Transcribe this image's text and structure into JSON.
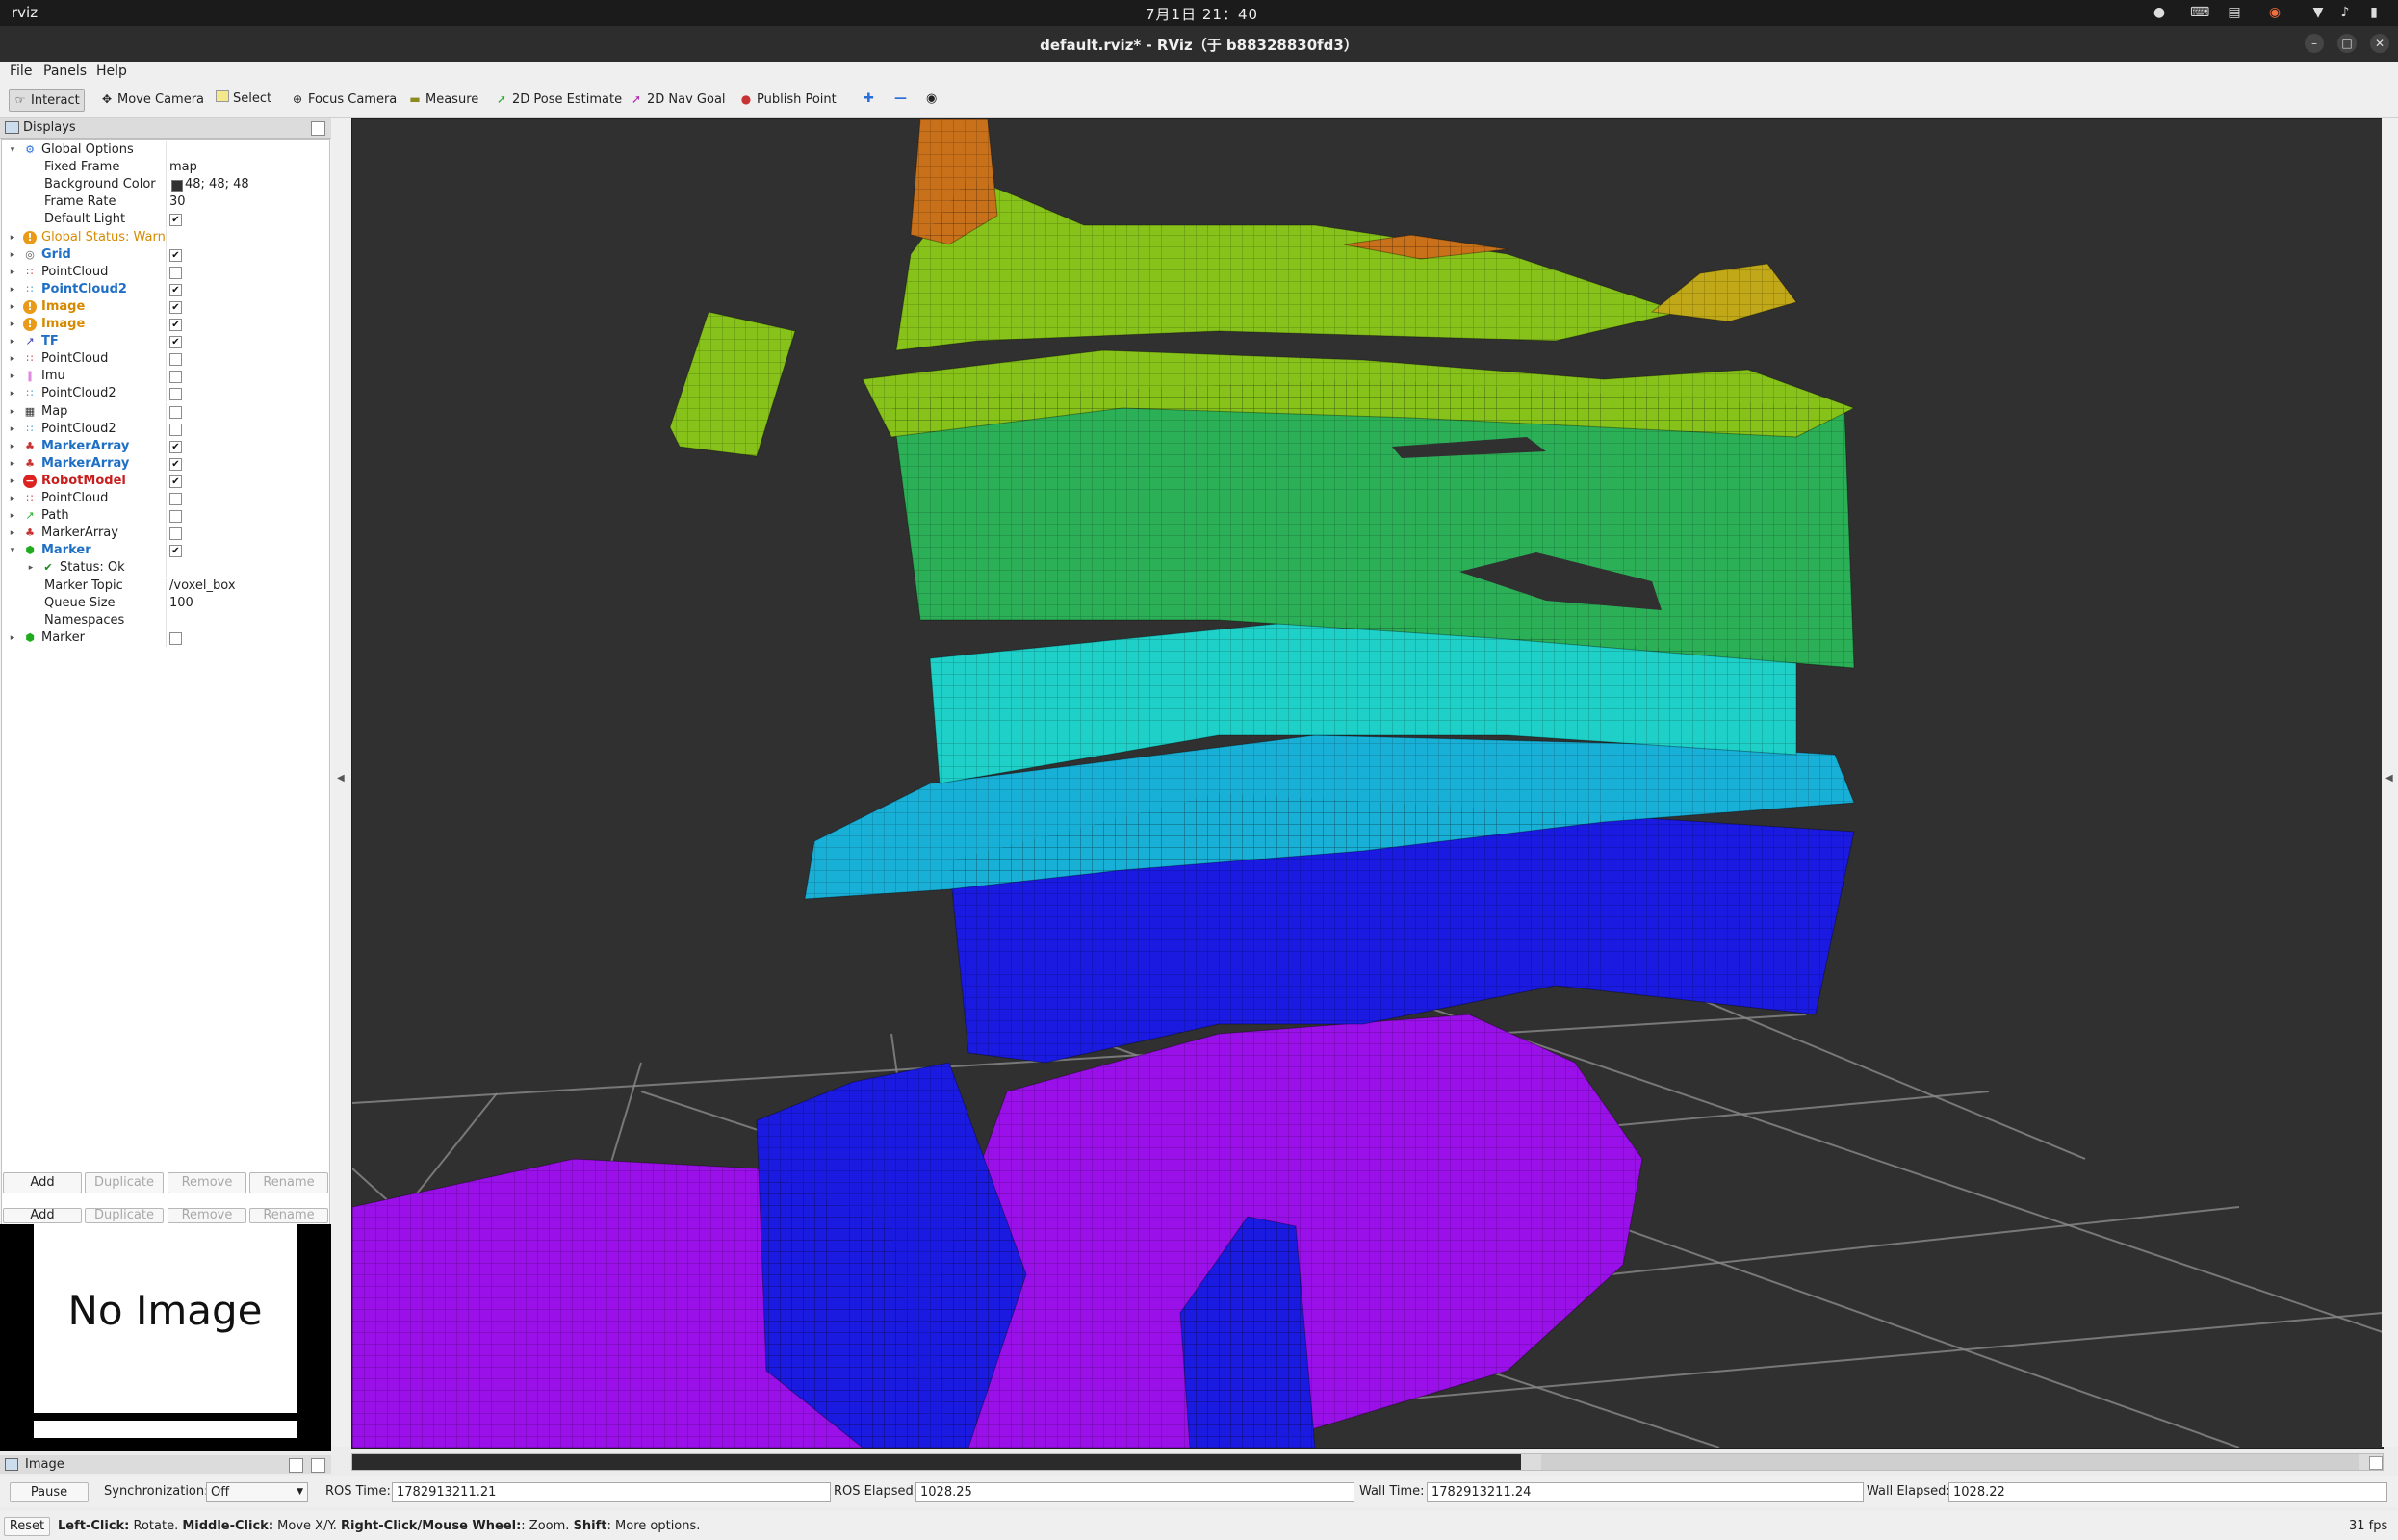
{
  "system_bar": {
    "app_name": "rviz",
    "clock": "7月1日 21：40"
  },
  "window": {
    "title": "default.rviz* - RViz（于 b88328830fd3）"
  },
  "menu": [
    "File",
    "Panels",
    "Help"
  ],
  "toolbar": {
    "tools": [
      {
        "label": "Interact",
        "icon": "interact-icon",
        "active": true
      },
      {
        "label": "Move Camera",
        "icon": "move-camera-icon"
      },
      {
        "label": "Select",
        "icon": "select-icon"
      },
      {
        "label": "Focus Camera",
        "icon": "focus-camera-icon"
      },
      {
        "label": "Measure",
        "icon": "measure-icon"
      },
      {
        "label": "2D Pose Estimate",
        "icon": "pose-estimate-icon"
      },
      {
        "label": "2D Nav Goal",
        "icon": "nav-goal-icon"
      },
      {
        "label": "Publish Point",
        "icon": "publish-point-icon"
      }
    ]
  },
  "displays": {
    "title": "Displays",
    "rows": [
      {
        "label": "Global Options",
        "arrow": "open",
        "icon": "gear-icon",
        "color": "#222"
      },
      {
        "label": "Fixed Frame",
        "value": "map",
        "indent": 2
      },
      {
        "label": "Background Color",
        "value": "48; 48; 48",
        "indent": 2,
        "swatch": "#303030"
      },
      {
        "label": "Frame Rate",
        "value": "30",
        "indent": 2
      },
      {
        "label": "Default Light",
        "check": true,
        "indent": 2
      },
      {
        "label": "Global Status: Warn",
        "arrow": "closed",
        "icon": "warning-icon",
        "color": "#d78a00"
      },
      {
        "label": "Grid",
        "arrow": "closed",
        "icon": "grid-icon",
        "check": true,
        "color": "#1f6fc5",
        "bold": true
      },
      {
        "label": "PointCloud",
        "arrow": "closed",
        "icon": "pointcloud-icon",
        "check": false
      },
      {
        "label": "PointCloud2",
        "arrow": "closed",
        "icon": "pointcloud2-icon",
        "check": true,
        "color": "#1f6fc5",
        "bold": true
      },
      {
        "label": "Image",
        "arrow": "closed",
        "icon": "warning-icon",
        "check": true,
        "color": "#d78a00",
        "bold": true
      },
      {
        "label": "Image",
        "arrow": "closed",
        "icon": "warning-icon",
        "check": true,
        "color": "#d78a00",
        "bold": true
      },
      {
        "label": "TF",
        "arrow": "closed",
        "icon": "tf-icon",
        "check": true,
        "color": "#1f6fc5",
        "bold": true
      },
      {
        "label": "PointCloud",
        "arrow": "closed",
        "icon": "pointcloud-icon",
        "check": false
      },
      {
        "label": "Imu",
        "arrow": "closed",
        "icon": "imu-icon",
        "check": false
      },
      {
        "label": "PointCloud2",
        "arrow": "closed",
        "icon": "pointcloud2-icon",
        "check": false
      },
      {
        "label": "Map",
        "arrow": "closed",
        "icon": "map-icon",
        "check": false
      },
      {
        "label": "PointCloud2",
        "arrow": "closed",
        "icon": "pointcloud2-icon",
        "check": false
      },
      {
        "label": "MarkerArray",
        "arrow": "closed",
        "icon": "marker-array-icon",
        "check": true,
        "color": "#1f6fc5",
        "bold": true
      },
      {
        "label": "MarkerArray",
        "arrow": "closed",
        "icon": "marker-array-icon",
        "check": true,
        "color": "#1f6fc5",
        "bold": true
      },
      {
        "label": "RobotModel",
        "arrow": "closed",
        "icon": "error-icon",
        "check": true,
        "color": "#c81e1e",
        "bold": true
      },
      {
        "label": "PointCloud",
        "arrow": "closed",
        "icon": "pointcloud-icon",
        "check": false
      },
      {
        "label": "Path",
        "arrow": "closed",
        "icon": "path-icon",
        "check": false
      },
      {
        "label": "MarkerArray",
        "arrow": "closed",
        "icon": "marker-array-icon",
        "check": false
      },
      {
        "label": "Marker",
        "arrow": "open",
        "icon": "marker-icon",
        "check": true,
        "color": "#1f6fc5",
        "bold": true
      },
      {
        "label": "Status: Ok",
        "arrow": "closed",
        "icon": "check-icon",
        "indent": 1
      },
      {
        "label": "Marker Topic",
        "value": "/voxel_box",
        "indent": 2
      },
      {
        "label": "Queue Size",
        "value": "100",
        "indent": 2
      },
      {
        "label": "Namespaces",
        "indent": 2
      },
      {
        "label": "Marker",
        "arrow": "closed",
        "icon": "marker-icon",
        "check": false
      }
    ],
    "buttons": [
      "Add",
      "Duplicate",
      "Remove",
      "Rename"
    ]
  },
  "image_panel": {
    "message": "No Image",
    "title": "Image"
  },
  "timebar": {
    "pause": "Pause",
    "sync_label": "Synchronization:",
    "sync_value": "Off",
    "ros_time_label": "ROS Time:",
    "ros_time": "1782913211.21",
    "ros_elapsed_label": "ROS Elapsed:",
    "ros_elapsed": "1028.25",
    "wall_time_label": "Wall Time:",
    "wall_time": "1782913211.24",
    "wall_elapsed_label": "Wall Elapsed:",
    "wall_elapsed": "1028.22"
  },
  "statusbar": {
    "reset": "Reset",
    "hint_bold_1": "Left-Click:",
    "hint_1": " Rotate. ",
    "hint_bold_2": "Middle-Click:",
    "hint_2": " Move X/Y. ",
    "hint_bold_3": "Right-Click/Mouse Wheel:",
    "hint_3": ": Zoom. ",
    "hint_bold_4": "Shift",
    "hint_4": ": More options.",
    "fps": "31 fps"
  },
  "view": {
    "background": "#303030",
    "grid_color": "#8a8a8a",
    "voxel_colors": [
      "#9a10e8",
      "#1a1ae0",
      "#19b0d8",
      "#1fd0c8",
      "#2bb058",
      "#86c21a",
      "#c0a818",
      "#c8701a"
    ]
  }
}
